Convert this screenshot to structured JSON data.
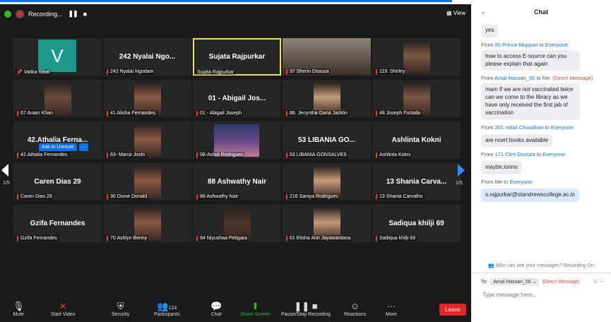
{
  "recording": {
    "label": "Recording...",
    "pause_icon": "pause-icon",
    "stop_icon": "stop-icon"
  },
  "view_label": "View",
  "ask_to_unmute": "Ask to Unmute",
  "more_dots": "···",
  "page_indicator": "1/5",
  "tiles": [
    {
      "big": "",
      "label": "Vatika Sibal",
      "avatar": "V",
      "pin": true
    },
    {
      "big": "242 Nyalai Ngo...",
      "label": "242 Nyalai Ngodam"
    },
    {
      "big": "Sujata Rajpurkar",
      "label": "Sujata Rajpurkar",
      "active": true
    },
    {
      "big": "",
      "label": "37 Sherin Dsouza",
      "photo": "wide"
    },
    {
      "big": "",
      "label": "119. Shirley",
      "photo": "face"
    },
    {
      "big": "",
      "label": "67 Anam Khan",
      "photo": "face"
    },
    {
      "big": "",
      "label": "41 Alisha Fernandes.",
      "photo": "face"
    },
    {
      "big": "01 - Abigail Jos...",
      "label": "01 - Abigail Joseph"
    },
    {
      "big": "",
      "label": "86. Jecyntha Gana Jacklin",
      "photo": "face"
    },
    {
      "big": "",
      "label": "48 Joseph Furtado",
      "photo": "face"
    },
    {
      "big": "42.Athalia Ferna...",
      "label": "42.Athalia Fernandes"
    },
    {
      "big": "",
      "label": "63- Mansi Joshi",
      "photo": "face"
    },
    {
      "big": "",
      "label": "08-Ashal Rodrigues",
      "photo": "scene"
    },
    {
      "big": "53 LIBANIA GO...",
      "label": "53 LIBANIA GONSALVES"
    },
    {
      "big": "Ashlinta Kokni",
      "label": "Ashlinta Kokni"
    },
    {
      "big": "Caren Dias 29",
      "label": "Caren Dias 29"
    },
    {
      "big": "",
      "label": "30 Dione Donald",
      "photo": "face"
    },
    {
      "big": "88 Ashwathy Nair",
      "label": "88 Ashwathy Nair"
    },
    {
      "big": "",
      "label": "216 Saniya Rodrigues",
      "photo": "face"
    },
    {
      "big": "13 Shania Carva...",
      "label": "13 Shania Carvalho"
    },
    {
      "big": "Gzifa Fernandes",
      "label": "Gzifa Fernandes"
    },
    {
      "big": "",
      "label": "70 Ashlyn Benny",
      "photo": "face"
    },
    {
      "big": "",
      "label": "94 Niyushaa Petigara",
      "photo": "face"
    },
    {
      "big": "",
      "label": "61 Elisha Ann Jayawardana",
      "photo": "face"
    },
    {
      "big": "Sadiqua khilji 69",
      "label": "Sadiqua khilji 69"
    }
  ],
  "toolbar": {
    "mute": "Mute",
    "start_video": "Start Video",
    "security": "Security",
    "participants": "Participants",
    "participants_count": "124",
    "chat": "Chat",
    "share_screen": "Share Screen",
    "pause_stop_recording": "Pause/Stop Recording",
    "reactions": "Reactions",
    "more": "More",
    "leave": "Leave"
  },
  "chat": {
    "title": "Chat",
    "messages": [
      {
        "sender": "",
        "text": "yes"
      },
      {
        "sender": "85 Prince Muppan",
        "to": "Everyone",
        "text": "how to access E-source can you please explain that again"
      },
      {
        "sender": "Amal Hassan_56",
        "to": "Me",
        "dm": "(Direct Message)",
        "text": "mam if we are not vaccinated twice can we come to the library as we have only received the first jab of vaccination"
      },
      {
        "sender": "201 mitali Choudhari",
        "to": "Everyone",
        "text": "are ncert books available"
      },
      {
        "sender": "171 Clint Dsouza",
        "to": "Everyone",
        "text": "maybe,ionno"
      },
      {
        "sender": "Me",
        "to": "Everyone",
        "text": "s.rajpurkar@standrewscollege.ac.in",
        "me": true
      }
    ],
    "privacy_note": "Who can see your messages? Recording On",
    "to_label": "To:",
    "to_recipient": "Amal Hassan_56",
    "to_dm": "(Direct Message)",
    "input_placeholder": "Type message here..."
  }
}
